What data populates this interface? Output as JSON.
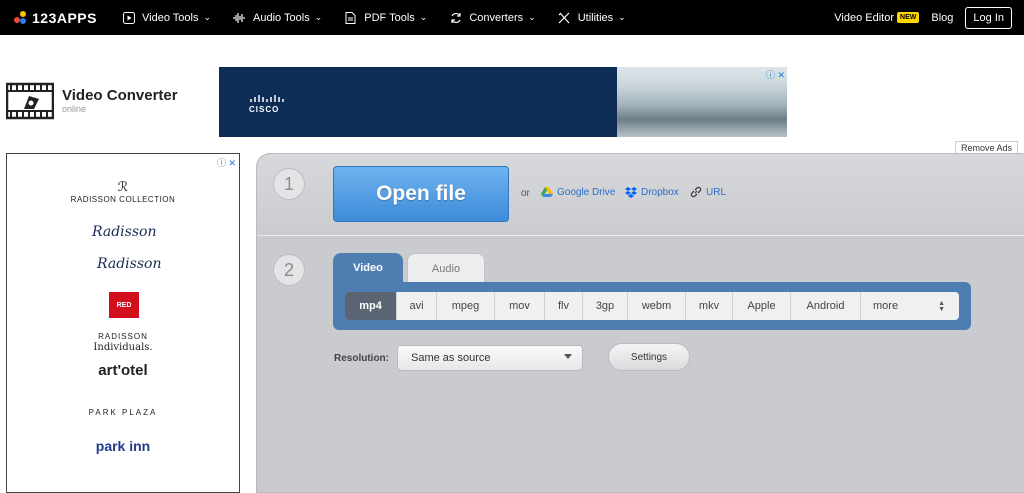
{
  "topbar": {
    "logo": "123APPS",
    "nav": [
      {
        "label": "Video Tools",
        "icon": "play-icon"
      },
      {
        "label": "Audio Tools",
        "icon": "waveform-icon"
      },
      {
        "label": "PDF Tools",
        "icon": "document-icon"
      },
      {
        "label": "Converters",
        "icon": "refresh-icon"
      },
      {
        "label": "Utilities",
        "icon": "tools-icon"
      }
    ],
    "video_editor": "Video Editor",
    "new_badge": "NEW",
    "blog": "Blog",
    "login": "Log In"
  },
  "brand": {
    "title": "Video Converter",
    "subtitle": "online"
  },
  "banner": {
    "advertiser": "CISCO"
  },
  "remove_ads": "Remove Ads",
  "side_ad": {
    "brands": [
      "RADISSON COLLECTION",
      "Radisson",
      "Radisson",
      "RED",
      "RADISSON",
      "Individuals.",
      "art'otel",
      "PARK PLAZA",
      "park inn"
    ]
  },
  "converter": {
    "step1": "1",
    "step2": "2",
    "open_file": "Open file",
    "or": "or",
    "sources": [
      "Google Drive",
      "Dropbox",
      "URL"
    ],
    "tabs": [
      "Video",
      "Audio"
    ],
    "formats": [
      "mp4",
      "avi",
      "mpeg",
      "mov",
      "flv",
      "3gp",
      "webm",
      "mkv",
      "Apple",
      "Android",
      "more"
    ],
    "selected_format": "mp4",
    "resolution_label": "Resolution:",
    "resolution_value": "Same as source",
    "settings": "Settings"
  },
  "colors": {
    "accent": "#4e7db2",
    "open_button": "#3d8bd9",
    "new_badge": "#ffd700"
  }
}
